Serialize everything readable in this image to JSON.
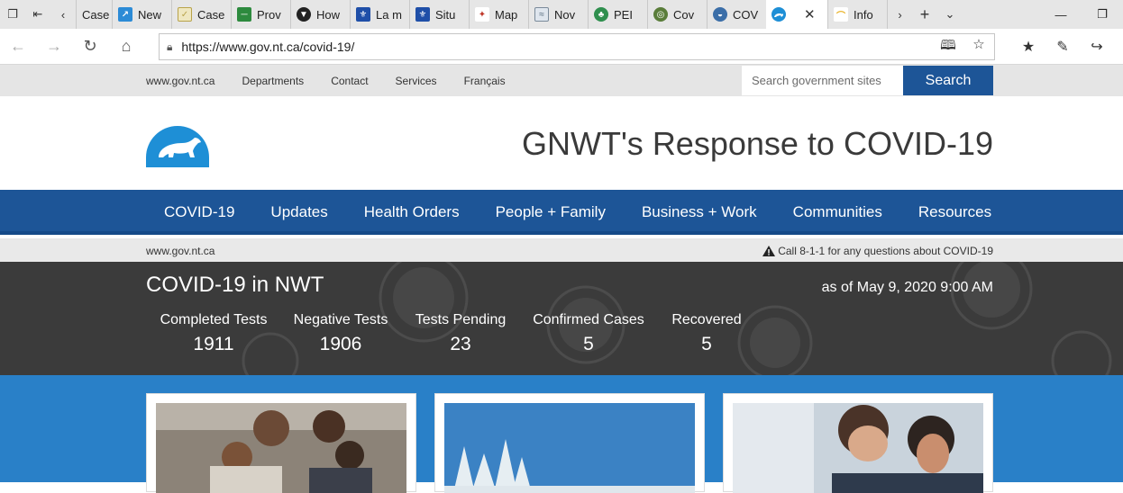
{
  "browser": {
    "tabs": [
      {
        "label": "Case",
        "fav_color": "#d9d9d9"
      },
      {
        "label": "New",
        "fav_color": "#2c8bd6"
      },
      {
        "label": "Case",
        "fav_color": "#b8a34a"
      },
      {
        "label": "Prov",
        "fav_color": "#2d8a3e"
      },
      {
        "label": "How",
        "fav_color": "#222222"
      },
      {
        "label": "La m",
        "fav_color": "#1f4fa8"
      },
      {
        "label": "Situ",
        "fav_color": "#1f4fa8"
      },
      {
        "label": "Map",
        "fav_color": "#c0392b"
      },
      {
        "label": "Nov",
        "fav_color": "#7a8a9a"
      },
      {
        "label": "PEI",
        "fav_color": "#2f8f4e"
      },
      {
        "label": "Cov",
        "fav_color": "#5a7d3a"
      },
      {
        "label": "COV",
        "fav_color": "#3b6ea8"
      }
    ],
    "active_tab": {
      "label": ""
    },
    "after_tab": {
      "label": "Info",
      "fav_color": "#e8b020"
    },
    "url": "https://www.gov.nt.ca/covid-19/"
  },
  "utility": {
    "links": [
      "www.gov.nt.ca",
      "Departments",
      "Contact",
      "Services",
      "Français"
    ],
    "search_placeholder": "Search government sites",
    "search_button": "Search"
  },
  "header": {
    "title": "GNWT's Response to COVID-19"
  },
  "nav": {
    "items": [
      "COVID-19",
      "Updates",
      "Health Orders",
      "People + Family",
      "Business + Work",
      "Communities",
      "Resources"
    ]
  },
  "crumb": {
    "home": "www.gov.nt.ca",
    "notice": "Call 8-1-1 for any questions about COVID-19"
  },
  "stats": {
    "title": "COVID-19 in NWT",
    "as_of": "as of May 9, 2020 9:00 AM",
    "items": [
      {
        "label": "Completed Tests",
        "value": "1911"
      },
      {
        "label": "Negative Tests",
        "value": "1906"
      },
      {
        "label": "Tests Pending",
        "value": "23"
      },
      {
        "label": "Confirmed Cases",
        "value": "5"
      },
      {
        "label": "Recovered",
        "value": "5"
      }
    ]
  },
  "colors": {
    "brand_blue": "#1d5597",
    "stats_bg": "#3b3b3b",
    "cards_bg": "#2980c8",
    "logo_blue": "#1e8fd6"
  }
}
